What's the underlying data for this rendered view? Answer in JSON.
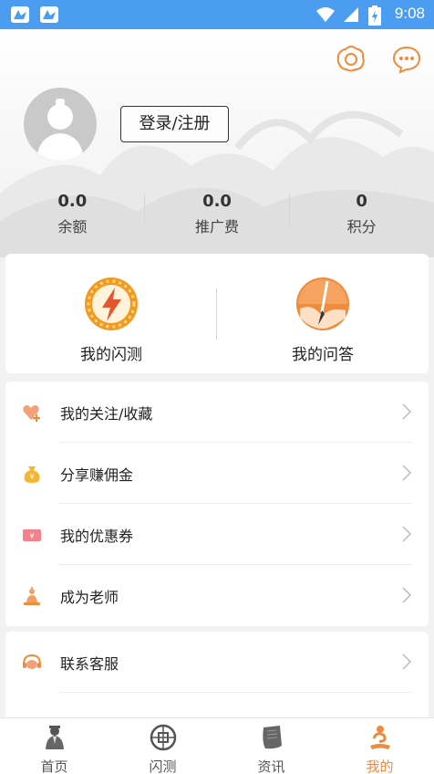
{
  "status_bar": {
    "time": "9:08"
  },
  "profile": {
    "login_label": "登录/注册"
  },
  "stats": [
    {
      "value": "0.0",
      "label": "余额"
    },
    {
      "value": "0.0",
      "label": "推广费"
    },
    {
      "value": "0",
      "label": "积分"
    }
  ],
  "quick_actions": [
    {
      "label": "我的闪测",
      "icon": "lightning-badge-icon"
    },
    {
      "label": "我的问答",
      "icon": "brush-fan-icon"
    }
  ],
  "menu_group_1": [
    {
      "label": "我的关注/收藏",
      "icon": "heart-plus-icon"
    },
    {
      "label": "分享赚佣金",
      "icon": "money-bag-icon"
    },
    {
      "label": "我的优惠券",
      "icon": "coupon-icon"
    },
    {
      "label": "成为老师",
      "icon": "teacher-icon"
    }
  ],
  "menu_group_2": [
    {
      "label": "联系客服",
      "icon": "customer-service-icon"
    }
  ],
  "tabs": [
    {
      "label": "首页",
      "icon": "sage-figure-icon",
      "active": false
    },
    {
      "label": "闪测",
      "icon": "coin-pattern-icon",
      "active": false
    },
    {
      "label": "资讯",
      "icon": "scroll-icon",
      "active": false
    },
    {
      "label": "我的",
      "icon": "my-figure-icon",
      "active": true
    }
  ],
  "colors": {
    "accent": "#f08a3c",
    "status_bar": "#4a9df0",
    "active_tab": "#f08a3c"
  }
}
